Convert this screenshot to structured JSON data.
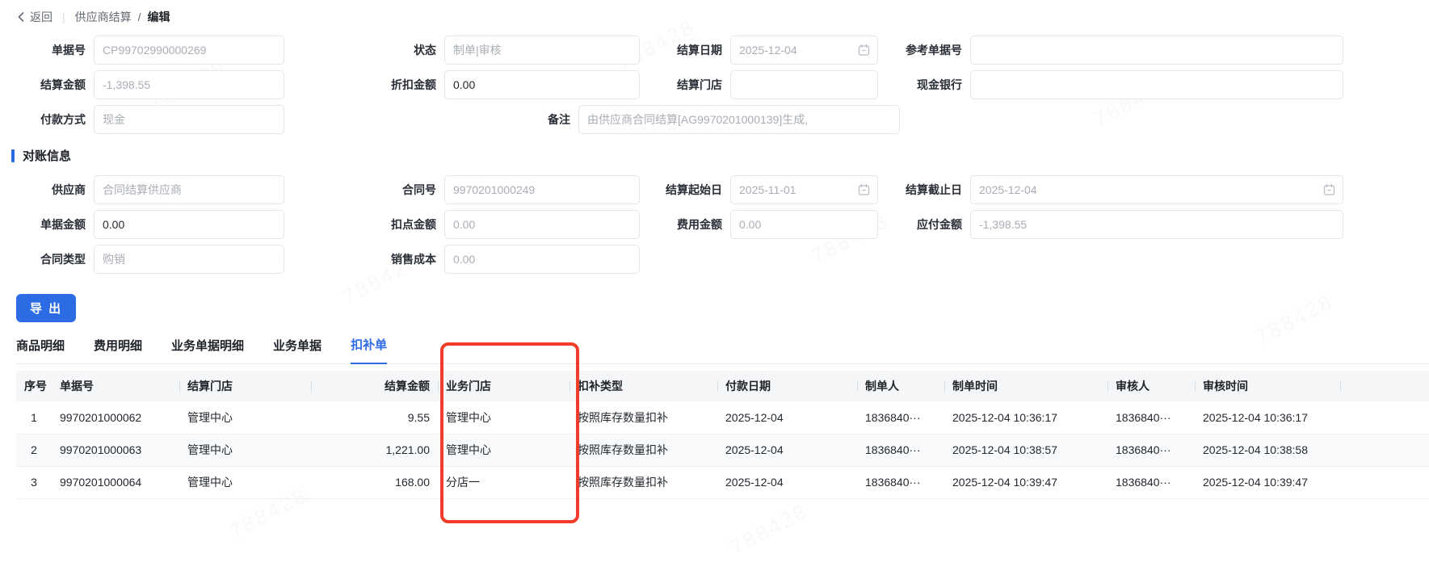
{
  "breadcrumb": {
    "back": "返回",
    "divider": "|",
    "section": "供应商结算",
    "slash": "/",
    "current": "编辑"
  },
  "watermark": "788428",
  "export_button": "导 出",
  "section_titles": {
    "reconcile": "对账信息"
  },
  "form": {
    "doc_no": {
      "label": "单据号",
      "value": "CP99702990000269"
    },
    "status": {
      "label": "状态",
      "value": "制单|审核"
    },
    "settle_date": {
      "label": "结算日期",
      "value": "2025-12-04"
    },
    "ref_doc_no": {
      "label": "参考单据号",
      "value": ""
    },
    "settle_amount": {
      "label": "结算金额",
      "value": "-1,398.55"
    },
    "discount_amount": {
      "label": "折扣金额",
      "value": "0.00"
    },
    "settle_store": {
      "label": "结算门店",
      "value": ""
    },
    "cash_bank": {
      "label": "现金银行",
      "value": ""
    },
    "pay_method": {
      "label": "付款方式",
      "value": "现金"
    },
    "remark": {
      "label": "备注",
      "value": "由供应商合同结算[AG9970201000139]生成,"
    },
    "supplier": {
      "label": "供应商",
      "value": "合同结算供应商"
    },
    "contract_no": {
      "label": "合同号",
      "value": "9970201000249"
    },
    "settle_start": {
      "label": "结算起始日",
      "value": "2025-11-01"
    },
    "settle_end": {
      "label": "结算截止日",
      "value": "2025-12-04"
    },
    "doc_amount": {
      "label": "单据金额",
      "value": "0.00"
    },
    "deduct_amount": {
      "label": "扣点金额",
      "value": "0.00"
    },
    "fee_amount": {
      "label": "费用金额",
      "value": "0.00"
    },
    "payable_amount": {
      "label": "应付金额",
      "value": "-1,398.55"
    },
    "contract_type": {
      "label": "合同类型",
      "value": "购销"
    },
    "sales_cost": {
      "label": "销售成本",
      "value": "0.00"
    }
  },
  "tabs": {
    "items": [
      "商品明细",
      "费用明细",
      "业务单据明细",
      "业务单据",
      "扣补单"
    ],
    "active": "扣补单"
  },
  "table": {
    "headers": [
      "序号",
      "单据号",
      "结算门店",
      "结算金额",
      "业务门店",
      "扣补类型",
      "付款日期",
      "制单人",
      "制单时间",
      "审核人",
      "审核时间"
    ],
    "rows": [
      [
        "1",
        "9970201000062",
        "管理中心",
        "9.55",
        "管理中心",
        "按照库存数量扣补",
        "2025-12-04",
        "1836840···",
        "2025-12-04 10:36:17",
        "1836840···",
        "2025-12-04 10:36:17"
      ],
      [
        "2",
        "9970201000063",
        "管理中心",
        "1,221.00",
        "管理中心",
        "按照库存数量扣补",
        "2025-12-04",
        "1836840···",
        "2025-12-04 10:38:57",
        "1836840···",
        "2025-12-04 10:38:58"
      ],
      [
        "3",
        "9970201000064",
        "管理中心",
        "168.00",
        "分店一",
        "按照库存数量扣补",
        "2025-12-04",
        "1836840···",
        "2025-12-04 10:39:47",
        "1836840···",
        "2025-12-04 10:39:47"
      ]
    ]
  },
  "colors": {
    "accent": "#2b6ce4",
    "tab_active": "#2e6be6",
    "annotation": "#f23c2a",
    "header_bg": "#f5f6f7"
  }
}
